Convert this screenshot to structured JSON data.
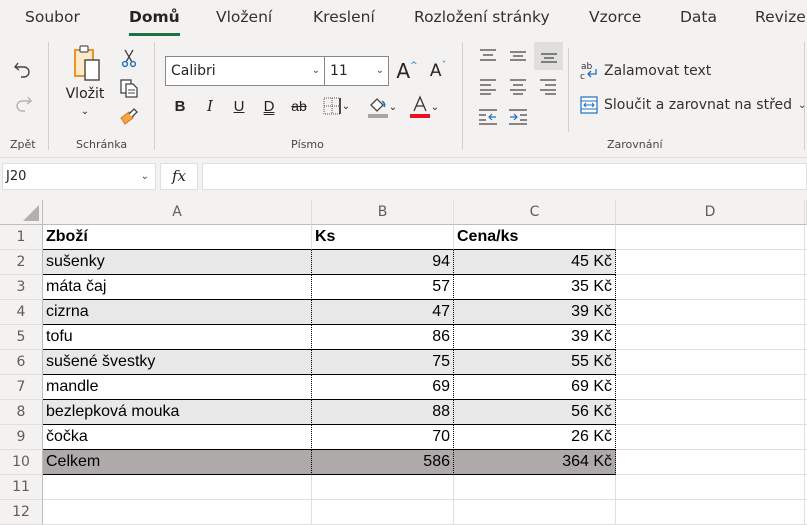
{
  "tabs": [
    {
      "label": "Soubor",
      "active": false
    },
    {
      "label": "Domů",
      "active": true
    },
    {
      "label": "Vložení",
      "active": false
    },
    {
      "label": "Kreslení",
      "active": false
    },
    {
      "label": "Rozložení stránky",
      "active": false
    },
    {
      "label": "Vzorce",
      "active": false
    },
    {
      "label": "Data",
      "active": false
    },
    {
      "label": "Revize",
      "active": false
    }
  ],
  "ribbon": {
    "undo_group": {
      "label": "Zpět",
      "undo_icon": "undo-icon",
      "redo_icon": "redo-icon"
    },
    "clipboard_group": {
      "label": "Schránka",
      "paste_label": "Vložit",
      "icons": [
        "paste-icon",
        "cut-icon",
        "copy-icon",
        "format-painter-icon"
      ]
    },
    "font_group": {
      "label": "Písmo",
      "font_name": "Calibri",
      "font_size": "11",
      "grow_font": "A",
      "shrink_font": "A",
      "bold": "B",
      "italic": "I",
      "underline": "U",
      "double_underline": "D",
      "strikethrough": "ab",
      "fill_color": "#a6a6a6",
      "font_color": "#e81123"
    },
    "alignment_group": {
      "label": "Zarovnání",
      "wrap_text": "Zalamovat text",
      "merge_center": "Sloučit a zarovnat na střed"
    }
  },
  "formula_bar": {
    "name_box": "J20",
    "fx_label": "fx",
    "formula": ""
  },
  "sheet": {
    "columns": [
      "A",
      "B",
      "C",
      "D"
    ],
    "row_numbers": [
      "1",
      "2",
      "3",
      "4",
      "5",
      "6",
      "7",
      "8",
      "9",
      "10",
      "11",
      "12"
    ],
    "header": [
      "Zboží",
      "Ks",
      "Cena/ks"
    ],
    "rows": [
      [
        "sušenky",
        "94",
        "45 Kč"
      ],
      [
        "máta čaj",
        "57",
        "35 Kč"
      ],
      [
        "cizrna",
        "47",
        "39 Kč"
      ],
      [
        "tofu",
        "86",
        "39 Kč"
      ],
      [
        "sušené švestky",
        "75",
        "55 Kč"
      ],
      [
        "mandle",
        "69",
        "69 Kč"
      ],
      [
        "bezlepková mouka",
        "88",
        "56 Kč"
      ],
      [
        "čočka",
        "70",
        "26 Kč"
      ]
    ],
    "total": [
      "Celkem",
      "586",
      "364 Kč"
    ],
    "colors": {
      "band": "#e8e8e8",
      "total": "#aeaaaa",
      "accent": "#1e7145"
    }
  }
}
